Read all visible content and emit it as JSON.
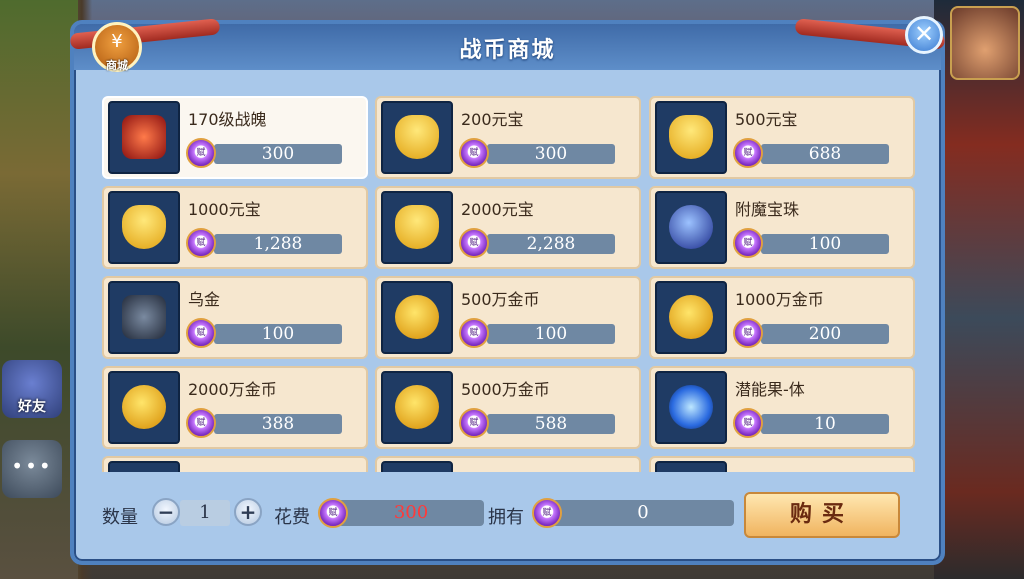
{
  "window": {
    "title": "战币商城",
    "close_glyph": "✕"
  },
  "shop_icon": {
    "label": "商城",
    "glyph": "¥"
  },
  "side": {
    "friends_label": "好友",
    "chat_glyph": "•••"
  },
  "currency_icon_text": "赋",
  "items": [
    {
      "name": "170级战魄",
      "price": "300",
      "art": "soul",
      "selected": true
    },
    {
      "name": "200元宝",
      "price": "300",
      "art": "ingot"
    },
    {
      "name": "500元宝",
      "price": "688",
      "art": "ingot"
    },
    {
      "name": "1000元宝",
      "price": "1,288",
      "art": "ingot"
    },
    {
      "name": "2000元宝",
      "price": "2,288",
      "art": "ingot"
    },
    {
      "name": "附魔宝珠",
      "price": "100",
      "art": "orb"
    },
    {
      "name": "乌金",
      "price": "100",
      "art": "ore"
    },
    {
      "name": "500万金币",
      "price": "100",
      "art": "coin"
    },
    {
      "name": "1000万金币",
      "price": "200",
      "art": "coin"
    },
    {
      "name": "2000万金币",
      "price": "388",
      "art": "coin"
    },
    {
      "name": "5000万金币",
      "price": "588",
      "art": "coin"
    },
    {
      "name": "潜能果-体",
      "price": "10",
      "art": "energy"
    },
    {
      "name": "",
      "price": "",
      "art": "energy"
    },
    {
      "name": "",
      "price": "",
      "art": "energy"
    },
    {
      "name": "",
      "price": "",
      "art": "energy"
    }
  ],
  "purchase": {
    "qty_label": "数量",
    "qty_value": "1",
    "minus_glyph": "−",
    "plus_glyph": "+",
    "cost_label": "花费",
    "cost_value": "300",
    "owned_label": "拥有",
    "owned_value": "0",
    "buy_label": "购买"
  }
}
